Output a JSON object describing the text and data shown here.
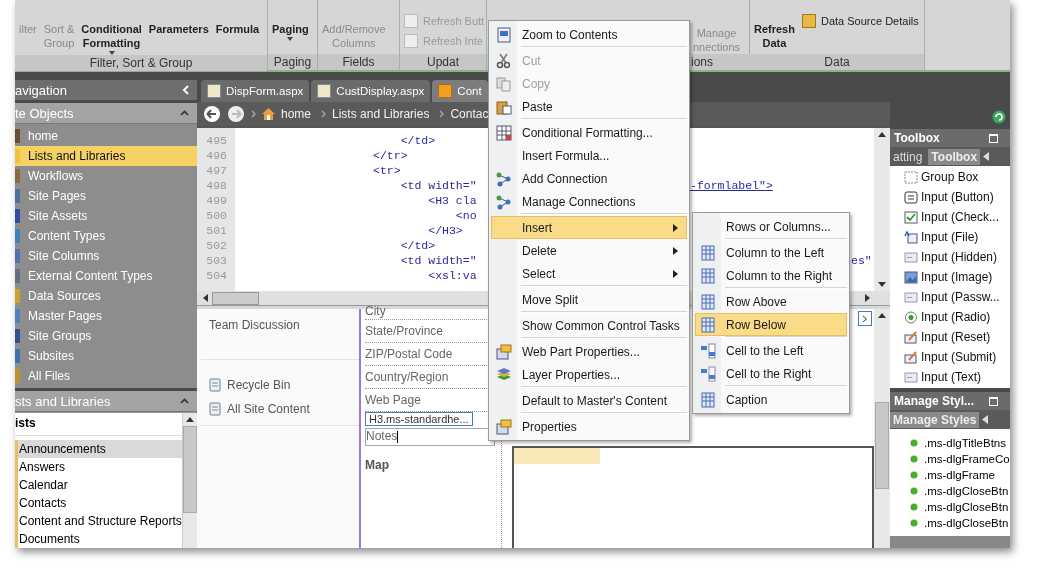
{
  "ribbon": {
    "groups": [
      {
        "label": "Filter, Sort & Group",
        "buttons": [
          {
            "label": "ilter",
            "disabled": true,
            "caret": false
          },
          {
            "label": "Sort &\nGroup",
            "disabled": true,
            "caret": false
          },
          {
            "label": "Conditional\nFormatting",
            "disabled": false,
            "caret": true
          },
          {
            "label": "Parameters",
            "disabled": false,
            "caret": false
          },
          {
            "label": "Formula",
            "disabled": false,
            "caret": false
          }
        ]
      },
      {
        "label": "Paging",
        "buttons": [
          {
            "label": "Paging",
            "disabled": false,
            "caret": true
          }
        ]
      },
      {
        "label": "Fields",
        "buttons": [
          {
            "label": "Add/Remove\nColumns",
            "disabled": true,
            "caret": false
          }
        ]
      },
      {
        "label": "Updat",
        "small_buttons": [
          {
            "label": "Refresh Butt",
            "disabled": true
          },
          {
            "label": "Refresh Inte",
            "disabled": true
          }
        ]
      },
      {
        "label": "ions",
        "buttons": [
          {
            "label": "Manage\nnnections",
            "disabled": true,
            "caret": false
          }
        ]
      },
      {
        "label": "Data",
        "buttons": [
          {
            "label": "Refresh\nData",
            "disabled": false,
            "caret": false
          }
        ],
        "small_buttons": [
          {
            "label": "Data Source Details",
            "disabled": false
          }
        ]
      }
    ]
  },
  "navigation": {
    "title": "avigation",
    "site_objects": {
      "title": "te Objects",
      "items": [
        {
          "label": "home",
          "selected": false
        },
        {
          "label": "Lists and Libraries",
          "selected": true
        },
        {
          "label": "Workflows",
          "selected": false
        },
        {
          "label": "Site Pages",
          "selected": false
        },
        {
          "label": "Site Assets",
          "selected": false
        },
        {
          "label": "Content Types",
          "selected": false
        },
        {
          "label": "Site Columns",
          "selected": false
        },
        {
          "label": "External Content Types",
          "selected": false
        },
        {
          "label": "Data Sources",
          "selected": false
        },
        {
          "label": "Master Pages",
          "selected": false
        },
        {
          "label": "Site Groups",
          "selected": false
        },
        {
          "label": "Subsites",
          "selected": false
        },
        {
          "label": "All Files",
          "selected": false
        }
      ]
    },
    "lists_and_libraries": {
      "title": "sts and Libraries",
      "heading": "ists",
      "items": [
        {
          "label": "Announcements",
          "selected": true
        },
        {
          "label": "Answers",
          "selected": false
        },
        {
          "label": "Calendar",
          "selected": false
        },
        {
          "label": "Contacts",
          "selected": false
        },
        {
          "label": "Content and Structure Reports",
          "selected": false
        },
        {
          "label": "Documents",
          "selected": false
        }
      ]
    }
  },
  "tabs": [
    {
      "label": "DispForm.aspx",
      "selected": false
    },
    {
      "label": "CustDisplay.aspx",
      "selected": false
    },
    {
      "label": "Cont",
      "selected": true
    }
  ],
  "breadcrumb": [
    "home",
    "Lists and Libraries",
    "Contac"
  ],
  "code": {
    "lines": [
      {
        "number": "495",
        "text": "                        </td>"
      },
      {
        "number": "496",
        "text": "                    </tr>"
      },
      {
        "number": "497",
        "text": "                    <tr>"
      },
      {
        "number": "498",
        "text": "                        <td width=\"",
        "tail": "-formlabel\">"
      },
      {
        "number": "499",
        "text": "                            <H3 cla"
      },
      {
        "number": "500",
        "text": "                                <no"
      },
      {
        "number": "501",
        "text": "                            </H3>"
      },
      {
        "number": "502",
        "text": "                        </td>"
      },
      {
        "number": "503",
        "text": "                        <td width=\"",
        "tail": "es\""
      },
      {
        "number": "504",
        "text": "                            <xsl:va"
      }
    ]
  },
  "design": {
    "sidebar": {
      "top": "Team Discussion",
      "links": [
        "Recycle Bin",
        "All Site Content"
      ]
    },
    "fields": [
      "City",
      "State/Province",
      "ZIP/Postal Code",
      "Country/Region",
      "Web Page"
    ],
    "tag": "H3.ms-standardhe...",
    "notes": "Notes",
    "map": "Map"
  },
  "toolbox": {
    "title": "Toolbox",
    "tabs": [
      {
        "label": "atting",
        "selected": false
      },
      {
        "label": "Toolbox",
        "selected": true
      }
    ],
    "items": [
      "Group Box",
      "Input (Button)",
      "Input (Check...",
      "Input (File)",
      "Input (Hidden)",
      "Input (Image)",
      "Input (Passw...",
      "Input (Radio)",
      "Input (Reset)",
      "Input (Submit)",
      "Input (Text)"
    ]
  },
  "manage_styles": {
    "title": "Manage Styl...",
    "tabs": [
      {
        "label": "Manage Styles",
        "selected": true
      }
    ],
    "items": [
      ".ms-dlgTitleBtns",
      ".ms-dlgFrameCo",
      ".ms-dlgFrame",
      ".ms-dlgCloseBtn",
      ".ms-dlgCloseBtn",
      ".ms-dlgCloseBtn"
    ]
  },
  "context_menu": {
    "groups": [
      [
        {
          "label": "Zoom to Contents",
          "disabled": false,
          "selected": false,
          "submenu": false
        }
      ],
      [
        {
          "label": "Cut",
          "disabled": true,
          "selected": false,
          "submenu": false
        },
        {
          "label": "Copy",
          "disabled": true,
          "selected": false,
          "submenu": false
        },
        {
          "label": "Paste",
          "disabled": false,
          "selected": false,
          "submenu": false
        }
      ],
      [
        {
          "label": "Conditional Formatting...",
          "disabled": false,
          "selected": false,
          "submenu": false
        },
        {
          "label": "Insert Formula...",
          "disabled": false,
          "selected": false,
          "submenu": false
        },
        {
          "label": "Add Connection",
          "disabled": false,
          "selected": false,
          "submenu": false
        },
        {
          "label": "Manage Connections",
          "disabled": false,
          "selected": false,
          "submenu": false
        }
      ],
      [
        {
          "label": "Insert",
          "disabled": false,
          "selected": true,
          "submenu": true
        },
        {
          "label": "Delete",
          "disabled": false,
          "selected": false,
          "submenu": true
        },
        {
          "label": "Select",
          "disabled": false,
          "selected": false,
          "submenu": true
        }
      ],
      [
        {
          "label": "Move Split",
          "disabled": false,
          "selected": false,
          "submenu": false
        }
      ],
      [
        {
          "label": "Show Common Control Tasks",
          "disabled": false,
          "selected": false,
          "submenu": false
        }
      ],
      [
        {
          "label": "Web Part Properties...",
          "disabled": false,
          "selected": false,
          "submenu": false
        },
        {
          "label": "Layer Properties...",
          "disabled": false,
          "selected": false,
          "submenu": false
        }
      ],
      [
        {
          "label": "Default to Master's Content",
          "disabled": false,
          "selected": false,
          "submenu": false
        }
      ],
      [
        {
          "label": "Properties",
          "disabled": false,
          "selected": false,
          "submenu": false
        }
      ]
    ]
  },
  "submenu": {
    "groups": [
      [
        {
          "label": "Rows or Columns...",
          "selected": false
        }
      ],
      [
        {
          "label": "Column to the Left",
          "selected": false
        },
        {
          "label": "Column to the Right",
          "selected": false
        }
      ],
      [
        {
          "label": "Row Above",
          "selected": false
        },
        {
          "label": "Row Below",
          "selected": true
        }
      ],
      [
        {
          "label": "Cell to the Left",
          "selected": false
        },
        {
          "label": "Cell to the Right",
          "selected": false
        }
      ],
      [
        {
          "label": "Caption",
          "selected": false
        }
      ]
    ]
  }
}
